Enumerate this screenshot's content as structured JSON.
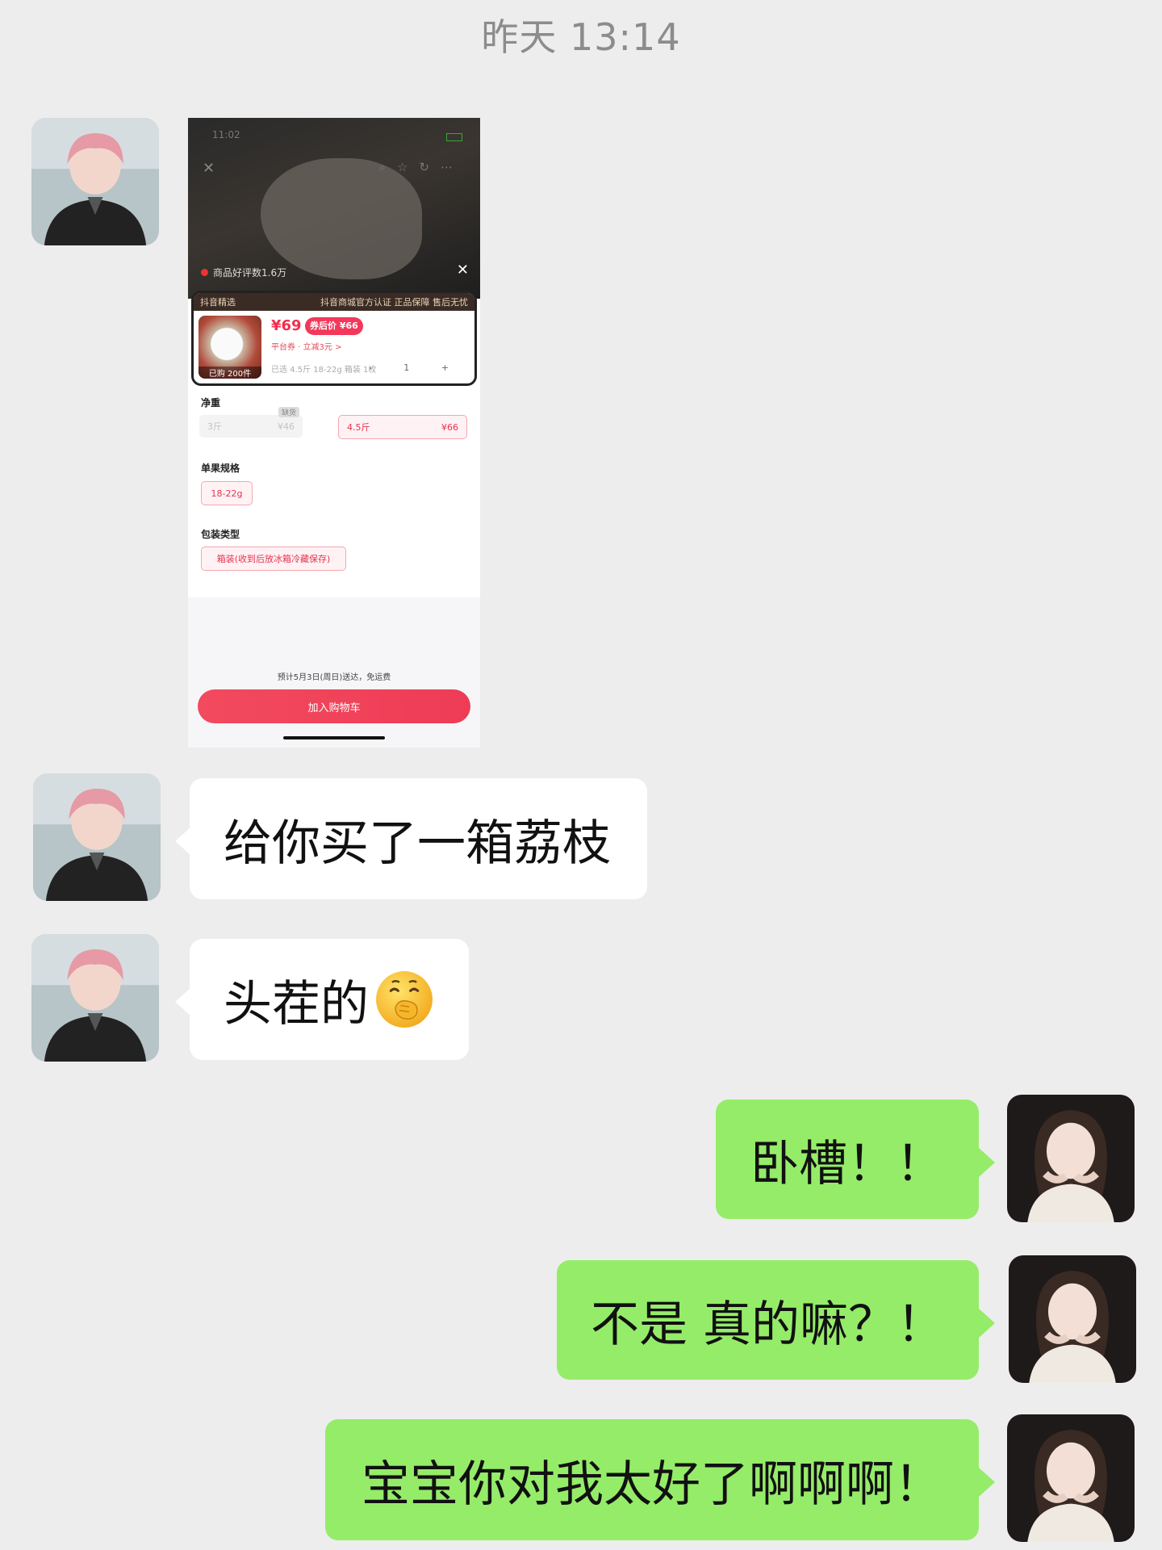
{
  "timestamp": "昨天 13:14",
  "product": {
    "rating": "商品好评数1.6万",
    "brand": "抖音精选",
    "assurances": "抖音商城官方认证  正品保障  售后无忧",
    "price": "¥69",
    "after_coupon": "券后价 ¥66",
    "coupon": "平台券 · 立减3元 >",
    "sold": "已购 200件",
    "spec_line": "已选 4.5斤 18-22g 箱装 1枚",
    "qty_controls": "- 1 +",
    "net_weight_label": "净重",
    "opt1_name": "3斤",
    "opt1_price": "¥46",
    "opt1_tag": "缺货",
    "opt2_name": "4.5斤",
    "opt2_price": "¥66",
    "single_size_label": "单果规格",
    "single_size": "18-22g",
    "pack_label": "包装类型",
    "pack": "箱装(收到后放冰箱冷藏保存)",
    "delivery": "预计5月3日(周日)送达，免运费",
    "cart_button": "加入购物车"
  },
  "messages": [
    {
      "side": "left",
      "text": "给你买了一箱荔枝"
    },
    {
      "side": "left",
      "text": "头茬的",
      "emoji": "face-with-hand-over-mouth"
    },
    {
      "side": "right",
      "text": "卧槽！！"
    },
    {
      "side": "right",
      "text": "不是 真的嘛？！"
    },
    {
      "side": "right",
      "text": "宝宝你对我太好了啊啊啊！"
    }
  ],
  "colors": {
    "background": "#ededed",
    "sent_bubble": "#95ec69",
    "received_bubble": "#ffffff"
  }
}
